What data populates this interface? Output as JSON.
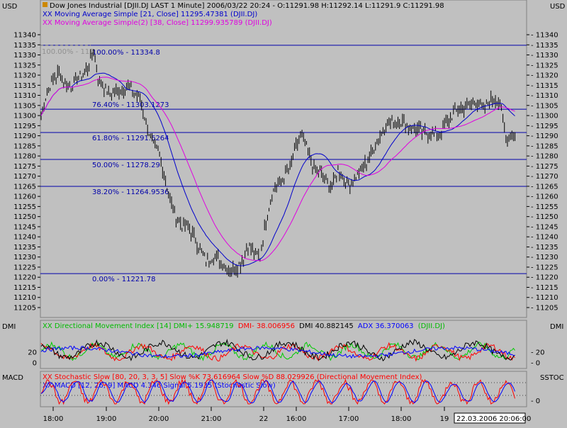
{
  "header": {
    "currency_left": "USD",
    "currency_right": "USD",
    "title": "Dow Jones Industrial [DJII.DJ LAST 1 Minute] 2006/03/22 20:24 - O:11291.98 H:11292.14 L:11291.9 C:11291.98",
    "ma1_legend": "XX Moving Average Simple [21, Close] 11295.47381 (DJII.DJ)",
    "ma2_legend": "XX Moving Average Simple(2) [38, Close] 11299.935789 (DJII.DJ)"
  },
  "colors": {
    "background": "#c0c0c0",
    "price": "#000000",
    "ma1": "#0000cc",
    "ma2": "#e000e0",
    "fib": "#0000aa",
    "dmi_plus": "#00cc00",
    "dmi_minus": "#ff0000",
    "adx": "#0000ff",
    "stoch_k": "#ff0000",
    "stoch_d": "#0000ff"
  },
  "fib_labels": {
    "f100": "100.00% - 11334.8",
    "f764": "76.40% - 11303.1273",
    "f618": "61.80% - 11291.6264",
    "f500": "50.00% - 11278.29",
    "f382": "38.20% - 11264.9536",
    "f000": "0.00% - 11221.78",
    "ghost": "100.00% - 113"
  },
  "dmi": {
    "label_left": "DMI",
    "label_right": "DMI",
    "legend_main": "XX Directional Movement Index [14] DMI+ 15.948719",
    "legend_minus": "DMI- 38.006956",
    "legend_dmi": "DMI 40.882145",
    "legend_adx": "ADX 36.370063",
    "legend_sym": "(DJII.DJ)"
  },
  "osc": {
    "label_left": "MACD",
    "label_right": "SSTOC",
    "legend1": "XX Stochastic Slow [80, 20, 3, 3, 5] Slow %K 73.616964 Slow %D 88.029926 (Directional Movement Index)",
    "legend2": "XX MACD [12, 26, 9] MACD 4.346 Signal 5.1935 (Stochastic Slow)"
  },
  "time_axis": {
    "labels": [
      "18:00",
      "19:00",
      "20:00",
      "21:00",
      "22",
      "16:00",
      "17:00",
      "18:00",
      "19"
    ],
    "cursor_label": "22.03.2006 20:06:00"
  },
  "chart_data": {
    "type": "line",
    "title": "Dow Jones Industrial [DJII.DJ LAST 1 Minute] 2006/03/22 20:24",
    "ylim": [
      11200,
      11345
    ],
    "y_ticks": [
      11205,
      11210,
      11215,
      11220,
      11225,
      11230,
      11235,
      11240,
      11245,
      11250,
      11255,
      11260,
      11265,
      11270,
      11275,
      11280,
      11285,
      11290,
      11295,
      11300,
      11305,
      11310,
      11315,
      11320,
      11325,
      11330,
      11335,
      11340
    ],
    "x_time_labels": [
      "18:00",
      "19:00",
      "20:00",
      "21:00",
      "22",
      "16:00",
      "17:00",
      "18:00",
      "19"
    ],
    "fibonacci_levels": [
      {
        "label": "100.00%",
        "value": 11334.8
      },
      {
        "label": "76.40%",
        "value": 11303.1273
      },
      {
        "label": "61.80%",
        "value": 11291.6264
      },
      {
        "label": "50.00%",
        "value": 11278.29
      },
      {
        "label": "38.20%",
        "value": 11264.9536
      },
      {
        "label": "0.00%",
        "value": 11221.78
      }
    ],
    "price_points": [
      {
        "t": 0,
        "v": 11300
      },
      {
        "t": 4,
        "v": 11312
      },
      {
        "t": 8,
        "v": 11318
      },
      {
        "t": 12,
        "v": 11321
      },
      {
        "t": 16,
        "v": 11316
      },
      {
        "t": 20,
        "v": 11314
      },
      {
        "t": 24,
        "v": 11318
      },
      {
        "t": 28,
        "v": 11320
      },
      {
        "t": 32,
        "v": 11325
      },
      {
        "t": 35,
        "v": 11333
      },
      {
        "t": 38,
        "v": 11318
      },
      {
        "t": 42,
        "v": 11314
      },
      {
        "t": 46,
        "v": 11310
      },
      {
        "t": 52,
        "v": 11313
      },
      {
        "t": 58,
        "v": 11314
      },
      {
        "t": 62,
        "v": 11311
      },
      {
        "t": 66,
        "v": 11308
      },
      {
        "t": 70,
        "v": 11297
      },
      {
        "t": 74,
        "v": 11286
      },
      {
        "t": 78,
        "v": 11282
      },
      {
        "t": 82,
        "v": 11272
      },
      {
        "t": 86,
        "v": 11258
      },
      {
        "t": 90,
        "v": 11250
      },
      {
        "t": 94,
        "v": 11246
      },
      {
        "t": 98,
        "v": 11245
      },
      {
        "t": 102,
        "v": 11240
      },
      {
        "t": 106,
        "v": 11234
      },
      {
        "t": 110,
        "v": 11228
      },
      {
        "t": 114,
        "v": 11230
      },
      {
        "t": 118,
        "v": 11229
      },
      {
        "t": 122,
        "v": 11226
      },
      {
        "t": 126,
        "v": 11223
      },
      {
        "t": 130,
        "v": 11225
      },
      {
        "t": 134,
        "v": 11228
      },
      {
        "t": 138,
        "v": 11236
      },
      {
        "t": 142,
        "v": 11232
      },
      {
        "t": 146,
        "v": 11230
      },
      {
        "t": 150,
        "v": 11248
      },
      {
        "t": 154,
        "v": 11262
      },
      {
        "t": 158,
        "v": 11266
      },
      {
        "t": 162,
        "v": 11270
      },
      {
        "t": 166,
        "v": 11274
      },
      {
        "t": 170,
        "v": 11284
      },
      {
        "t": 174,
        "v": 11290
      },
      {
        "t": 178,
        "v": 11282
      },
      {
        "t": 182,
        "v": 11274
      },
      {
        "t": 186,
        "v": 11272
      },
      {
        "t": 190,
        "v": 11268
      },
      {
        "t": 194,
        "v": 11264
      },
      {
        "t": 198,
        "v": 11274
      },
      {
        "t": 202,
        "v": 11268
      },
      {
        "t": 206,
        "v": 11266
      },
      {
        "t": 210,
        "v": 11270
      },
      {
        "t": 214,
        "v": 11273
      },
      {
        "t": 218,
        "v": 11278
      },
      {
        "t": 222,
        "v": 11284
      },
      {
        "t": 226,
        "v": 11290
      },
      {
        "t": 230,
        "v": 11296
      },
      {
        "t": 234,
        "v": 11296
      },
      {
        "t": 238,
        "v": 11298
      },
      {
        "t": 242,
        "v": 11296
      },
      {
        "t": 246,
        "v": 11294
      },
      {
        "t": 250,
        "v": 11293
      },
      {
        "t": 254,
        "v": 11292
      },
      {
        "t": 258,
        "v": 11291
      },
      {
        "t": 262,
        "v": 11290
      },
      {
        "t": 266,
        "v": 11292
      },
      {
        "t": 270,
        "v": 11296
      },
      {
        "t": 274,
        "v": 11300
      },
      {
        "t": 278,
        "v": 11303
      },
      {
        "t": 282,
        "v": 11304
      },
      {
        "t": 286,
        "v": 11305
      },
      {
        "t": 290,
        "v": 11308
      },
      {
        "t": 294,
        "v": 11303
      },
      {
        "t": 298,
        "v": 11306
      },
      {
        "t": 302,
        "v": 11309
      },
      {
        "t": 306,
        "v": 11306
      },
      {
        "t": 308,
        "v": 11298
      },
      {
        "t": 310,
        "v": 11289
      },
      {
        "t": 312,
        "v": 11290
      },
      {
        "t": 316,
        "v": 11291.98
      }
    ],
    "series": [
      {
        "name": "Moving Average Simple [21, Close]",
        "last": 11295.47381
      },
      {
        "name": "Moving Average Simple(2) [38, Close]",
        "last": 11299.935789
      }
    ],
    "dmi_ylim": [
      0,
      60
    ],
    "dmi_ticks": [
      0,
      20
    ],
    "dmi_last": {
      "DMI+": 15.948719,
      "DMI-": 38.006956,
      "DMI": 40.882145,
      "ADX": 36.370063
    },
    "stoch_ticks": [
      0
    ],
    "stoch_last": {
      "Slow %K": 73.616964,
      "Slow %D": 88.029926
    },
    "macd_last": {
      "MACD": 4.346,
      "Signal": 5.1935
    }
  }
}
